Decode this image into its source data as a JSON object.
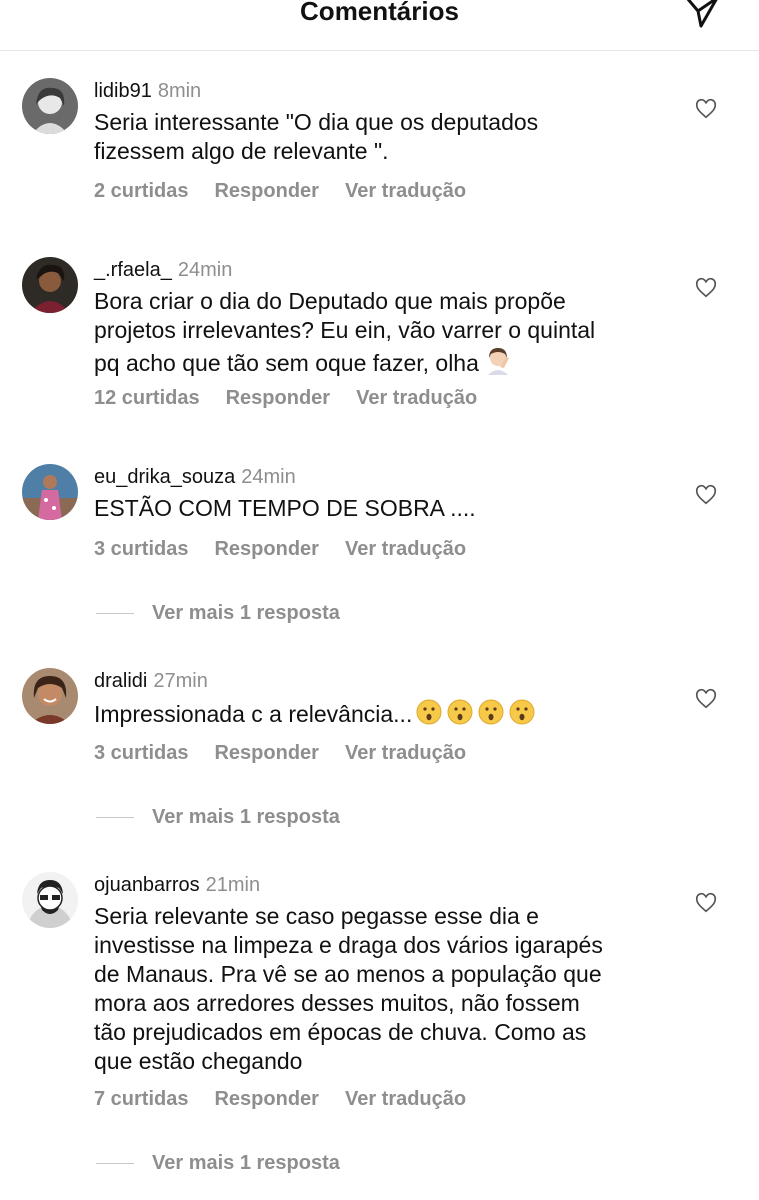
{
  "header": {
    "title": "Comentários"
  },
  "comments": [
    {
      "username": "lidib91",
      "time": "8min",
      "lines": [
        "Seria interessante \"O dia que os deputados",
        "fizessem algo de relevante \"."
      ],
      "likes": "2 curtidas",
      "reply": "Responder",
      "translate": "Ver tradução"
    },
    {
      "username": "_.rfaela_",
      "time": "24min",
      "lines": [
        "Bora criar o dia do Deputado que mais propõe",
        "projetos irrelevantes? Eu ein, vão varrer o quintal",
        "pq acho que tão sem oque fazer, olha"
      ],
      "emoji": "facepalm-emoji",
      "likes": "12 curtidas",
      "reply": "Responder",
      "translate": "Ver tradução"
    },
    {
      "username": "eu_drika_souza",
      "time": "24min",
      "lines": [
        "ESTÃO COM TEMPO DE SOBRA ...."
      ],
      "likes": "3 curtidas",
      "reply": "Responder",
      "translate": "Ver tradução",
      "more": "Ver mais 1 resposta"
    },
    {
      "username": "dralidi",
      "time": "27min",
      "lines": [
        "Impressionada c a relevância..."
      ],
      "emoji": "surprised-face-emoji x4",
      "likes": "3 curtidas",
      "reply": "Responder",
      "translate": "Ver tradução",
      "more": "Ver mais 1 resposta"
    },
    {
      "username": "ojuanbarros",
      "time": "21min",
      "lines": [
        "Seria relevante se caso pegasse esse dia e",
        "investisse na limpeza e draga dos vários igarapés",
        "de Manaus. Pra vê se ao menos a população que",
        "mora aos arredores desses muitos, não fossem",
        "tão prejudicados em épocas de chuva. Como as",
        "que estão chegando"
      ],
      "likes": "7 curtidas",
      "reply": "Responder",
      "translate": "Ver tradução",
      "more": "Ver mais 1 resposta"
    }
  ],
  "colors": {
    "text": "#111111",
    "muted": "#8e8e8e",
    "divider": "#e6e6e6"
  }
}
